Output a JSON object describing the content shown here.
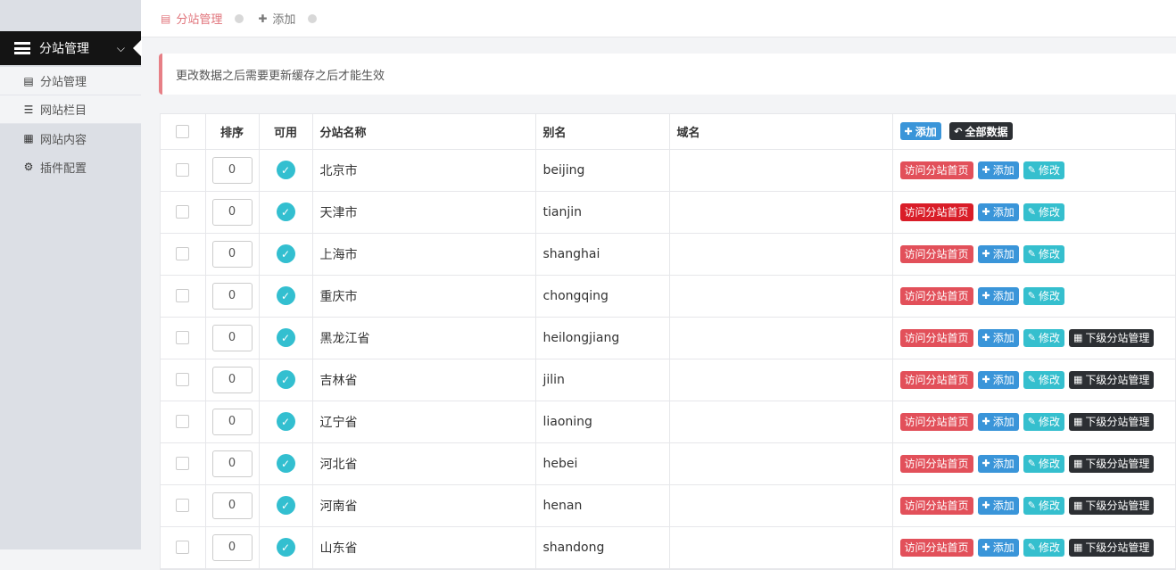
{
  "sidebar": {
    "header": {
      "label": "分站管理",
      "icon": "list-alt-icon"
    },
    "items": [
      {
        "label": "分站管理",
        "icon": "list-alt-icon",
        "active": true
      },
      {
        "label": "网站栏目",
        "icon": "bars-icon",
        "active": false
      },
      {
        "label": "网站内容",
        "icon": "th-large-icon",
        "active": false
      },
      {
        "label": "插件配置",
        "icon": "cog-icon",
        "active": false
      }
    ]
  },
  "tabs": [
    {
      "label": "分站管理",
      "icon": "list-alt-icon",
      "active": true
    },
    {
      "label": "添加",
      "icon": "plus-icon",
      "active": false
    }
  ],
  "alert": {
    "text": "更改数据之后需要更新缓存之后才能生效"
  },
  "table": {
    "headers": {
      "order": "排序",
      "enabled": "可用",
      "name": "分站名称",
      "alias": "别名",
      "domain": "域名"
    },
    "header_actions": {
      "add": "添加",
      "all": "全部数据"
    },
    "actions": {
      "visit": "访问分站首页",
      "add": "添加",
      "edit": "修改",
      "sub": "下级分站管理"
    },
    "rows": [
      {
        "order": "0",
        "name": "北京市",
        "alias": "beijing",
        "domain": "",
        "sub": false,
        "visit_hover": false
      },
      {
        "order": "0",
        "name": "天津市",
        "alias": "tianjin",
        "domain": "",
        "sub": false,
        "visit_hover": true
      },
      {
        "order": "0",
        "name": "上海市",
        "alias": "shanghai",
        "domain": "",
        "sub": false,
        "visit_hover": false
      },
      {
        "order": "0",
        "name": "重庆市",
        "alias": "chongqing",
        "domain": "",
        "sub": false,
        "visit_hover": false
      },
      {
        "order": "0",
        "name": "黑龙江省",
        "alias": "heilongjiang",
        "domain": "",
        "sub": true,
        "visit_hover": false
      },
      {
        "order": "0",
        "name": "吉林省",
        "alias": "jilin",
        "domain": "",
        "sub": true,
        "visit_hover": false
      },
      {
        "order": "0",
        "name": "辽宁省",
        "alias": "liaoning",
        "domain": "",
        "sub": true,
        "visit_hover": false
      },
      {
        "order": "0",
        "name": "河北省",
        "alias": "hebei",
        "domain": "",
        "sub": true,
        "visit_hover": false
      },
      {
        "order": "0",
        "name": "河南省",
        "alias": "henan",
        "domain": "",
        "sub": true,
        "visit_hover": false
      },
      {
        "order": "0",
        "name": "山东省",
        "alias": "shandong",
        "domain": "",
        "sub": true,
        "visit_hover": false
      }
    ]
  },
  "colors": {
    "accent": "#e0737a",
    "blue": "#3a95d9",
    "red": "#e2505a",
    "cyan": "#35bfce",
    "dark": "#2c2f33"
  }
}
